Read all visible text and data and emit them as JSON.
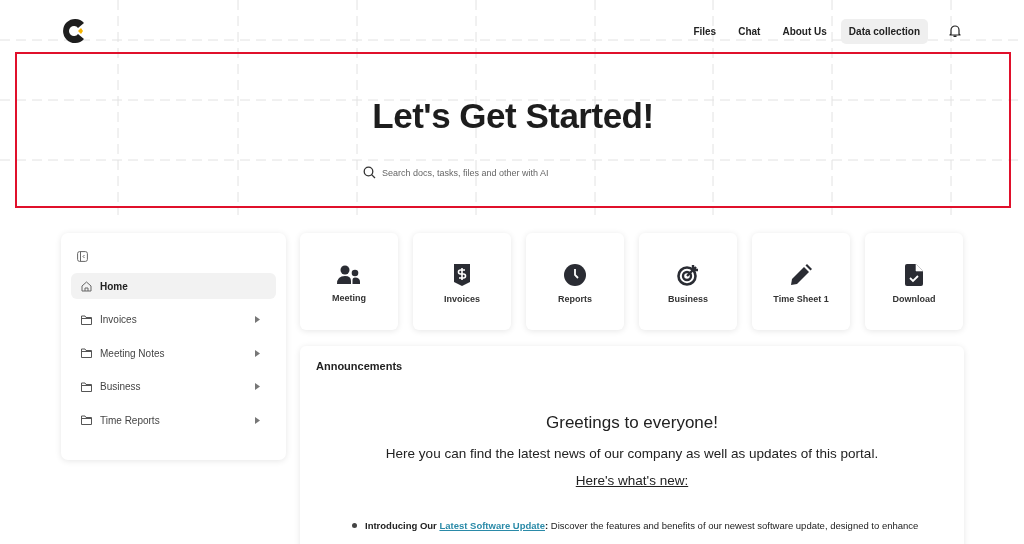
{
  "nav": {
    "items": [
      {
        "label": "Files",
        "selected": false
      },
      {
        "label": "Chat",
        "selected": false
      },
      {
        "label": "About Us",
        "selected": false
      },
      {
        "label": "Data collection",
        "selected": true
      }
    ]
  },
  "hero": {
    "title": "Let's Get Started!",
    "search": {
      "placeholder": "Search docs, tasks, files and other with AI"
    }
  },
  "sidebar": {
    "items": [
      {
        "label": "Home",
        "kind": "home",
        "selected": true,
        "has_children": false
      },
      {
        "label": "Invoices",
        "kind": "folder",
        "selected": false,
        "has_children": true
      },
      {
        "label": "Meeting Notes",
        "kind": "folder",
        "selected": false,
        "has_children": true
      },
      {
        "label": "Business",
        "kind": "folder",
        "selected": false,
        "has_children": true
      },
      {
        "label": "Time Reports",
        "kind": "folder",
        "selected": false,
        "has_children": true
      }
    ]
  },
  "tiles": [
    {
      "label": "Meeting",
      "kind": "people"
    },
    {
      "label": "Invoices",
      "kind": "dollar"
    },
    {
      "label": "Reports",
      "kind": "clock"
    },
    {
      "label": "Business",
      "kind": "target"
    },
    {
      "label": "Time Sheet 1",
      "kind": "pencil"
    },
    {
      "label": "Download",
      "kind": "file-check"
    }
  ],
  "announcements": {
    "title": "Announcements",
    "greeting": "Greetings to everyone!",
    "intro": "Here you can find the latest news of our company as well as updates of this portal.",
    "subheading": "Here's what's new:",
    "items": [
      {
        "lead": "**Introducing Our**",
        "link": "Latest Software Update",
        "text": "**:** Discover the features and benefits of our newest software update, designed to enhance"
      }
    ]
  }
}
